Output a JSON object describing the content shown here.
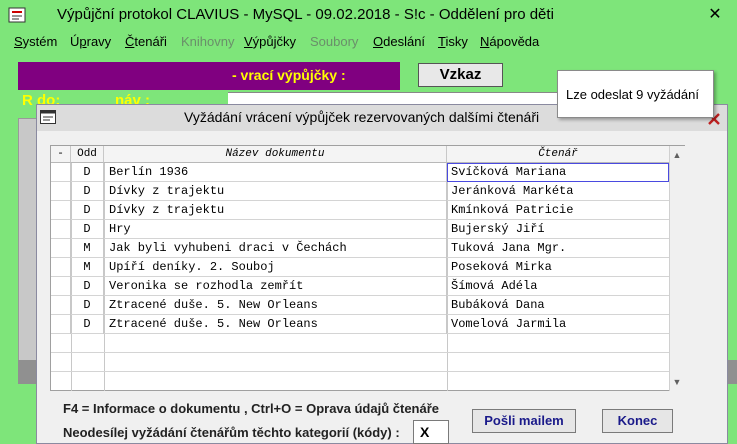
{
  "window": {
    "title": "Výpůjční protokol CLAVIUS - MySQL - 09.02.2018 - S!c - Oddělení pro děti",
    "close_glyph": "✕"
  },
  "menu": [
    {
      "label": "Systém",
      "underline": "S"
    },
    {
      "label": "Úpravy",
      "underline": "p"
    },
    {
      "label": "Čtenáři",
      "underline": "Č"
    },
    {
      "label": "Knihovny",
      "underline": "",
      "disabled": true
    },
    {
      "label": "Výpůjčky",
      "underline": "V"
    },
    {
      "label": "Soubory",
      "underline": "",
      "disabled": true
    },
    {
      "label": "Odeslání",
      "underline": "O"
    },
    {
      "label": "Tisky",
      "underline": "T"
    },
    {
      "label": "Nápověda",
      "underline": "N"
    }
  ],
  "background": {
    "purple_text": "- vrací výpůjčky :",
    "vzkaz_button": "Vzkaz",
    "r_do": "R do:",
    "nav": "náv :"
  },
  "tooltip": {
    "text": "Lze odeslat 9 vyžádání"
  },
  "dialog": {
    "title": "Vyžádání vrácení výpůjček rezervovaných dalšími čtenáři",
    "columns": {
      "sel": "-",
      "odd": "Odd",
      "name": "Název dokumentu",
      "reader": "Čtenář"
    },
    "rows": [
      {
        "odd": "D",
        "name": "Berlín 1936",
        "reader": "Svíčková Mariana"
      },
      {
        "odd": "D",
        "name": "Dívky z trajektu",
        "reader": "Jeránková Markéta"
      },
      {
        "odd": "D",
        "name": "Dívky z trajektu",
        "reader": "Kmínková Patricie"
      },
      {
        "odd": "D",
        "name": "Hry",
        "reader": "Bujerský Jiří"
      },
      {
        "odd": "M",
        "name": "Jak byli vyhubeni draci v Čechách",
        "reader": "Tuková Jana Mgr."
      },
      {
        "odd": "M",
        "name": "Upíří deníky. 2. Souboj",
        "reader": "Poseková Mirka"
      },
      {
        "odd": "D",
        "name": "Veronika se rozhodla zemřít",
        "reader": "Šímová Adéla"
      },
      {
        "odd": "D",
        "name": "Ztracené duše. 5. New Orleans",
        "reader": "Bubáková Dana"
      },
      {
        "odd": "D",
        "name": "Ztracené duše. 5. New Orleans",
        "reader": "Vomelová Jarmila"
      }
    ],
    "help_text": "F4 = Informace o dokumentu , Ctrl+O = Oprava údajů čtenáře",
    "category_label": "Neodesílej vyžádání čtenářům těchto kategorií (kódy) :",
    "category_value": "X",
    "send_button": "Pošli mailem",
    "close_button": "Konec"
  }
}
